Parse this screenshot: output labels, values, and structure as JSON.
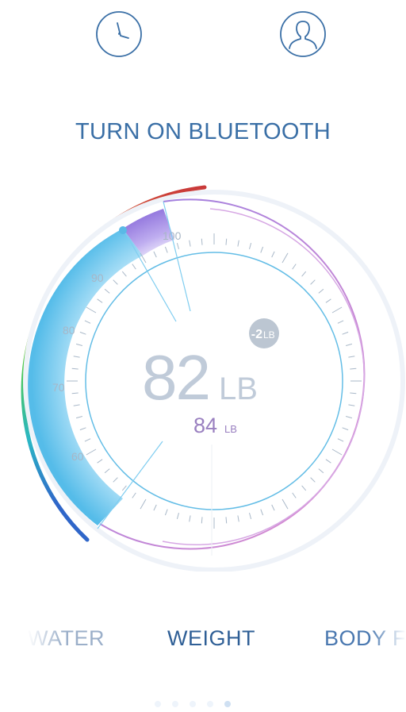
{
  "header": {
    "history_icon": "clock-icon",
    "profile_icon": "user-icon"
  },
  "status": {
    "bluetooth_prompt": "TURN ON BLUETOOTH"
  },
  "gauge": {
    "current_value": "82",
    "current_unit": "LB",
    "previous_value": "84",
    "previous_unit": "LB",
    "delta_label": "-2",
    "delta_unit": "LB",
    "scale_labels": [
      "60",
      "70",
      "80",
      "90",
      "100"
    ],
    "current_weight": 82,
    "target_weight": 100,
    "colors": {
      "primary_text": "#c0cbd9",
      "secondary_text": "#9a80c0",
      "accent_blue": "#55b8e6",
      "accent_purple": "#8f72dc",
      "outer_ring": "#cc93dc"
    }
  },
  "tabs": [
    {
      "label": "WATER"
    },
    {
      "label": "WEIGHT"
    },
    {
      "label": "BODY F"
    }
  ],
  "pager": {
    "count": 5,
    "active_index": 4
  }
}
